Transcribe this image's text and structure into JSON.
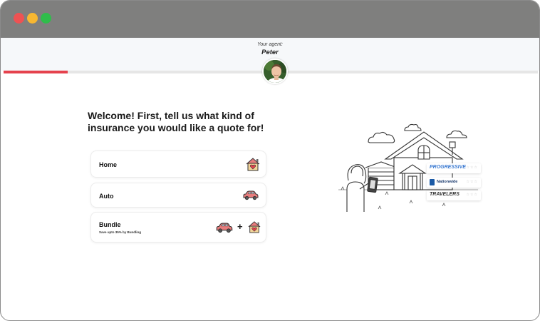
{
  "window": {
    "controls": [
      "close",
      "minimize",
      "maximize"
    ]
  },
  "agent": {
    "caption": "Your agent:",
    "name": "Peter"
  },
  "progress": {
    "fraction": 0.12,
    "color": "#e5424d"
  },
  "main": {
    "headline": "Welcome! First, tell us what kind of insurance you would like a quote for!",
    "options": [
      {
        "title": "Home",
        "icon": "house-heart-icon"
      },
      {
        "title": "Auto",
        "icon": "car-icon"
      },
      {
        "title": "Bundle",
        "subtitle": "Save upto 35% by Bundling",
        "icons": [
          "car-icon",
          "house-heart-icon"
        ],
        "joiner": "+"
      }
    ]
  },
  "carriers": [
    {
      "name": "PROGRESSIVE",
      "rating": "☆☆☆"
    },
    {
      "name": "Nationwide",
      "rating": "☆☆☆"
    },
    {
      "name": "TRAVELERS",
      "rating": "☆☆☆"
    }
  ],
  "colors": {
    "titlebar": "#7f7f7e",
    "accent": "#e5424d",
    "car": "#e77c7c",
    "house_roof": "#e77c7c",
    "house_wall": "#f3d59a"
  }
}
